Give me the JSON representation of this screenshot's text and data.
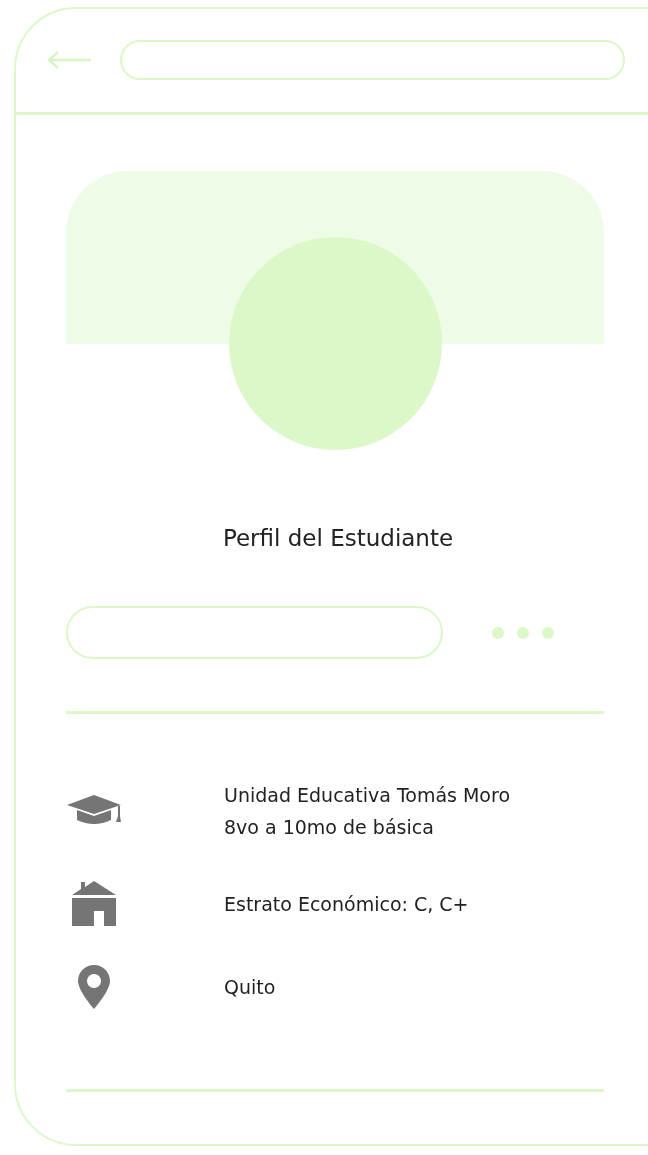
{
  "profile": {
    "title": "Perfil del Estudiante"
  },
  "info": [
    {
      "kind": "school",
      "lines": [
        "Unidad Educativa Tomás Moro",
        "8vo a 10mo de básica"
      ]
    },
    {
      "kind": "home",
      "lines": [
        "Estrato Económico: C, C+"
      ]
    },
    {
      "kind": "location",
      "lines": [
        "Quito"
      ]
    }
  ]
}
